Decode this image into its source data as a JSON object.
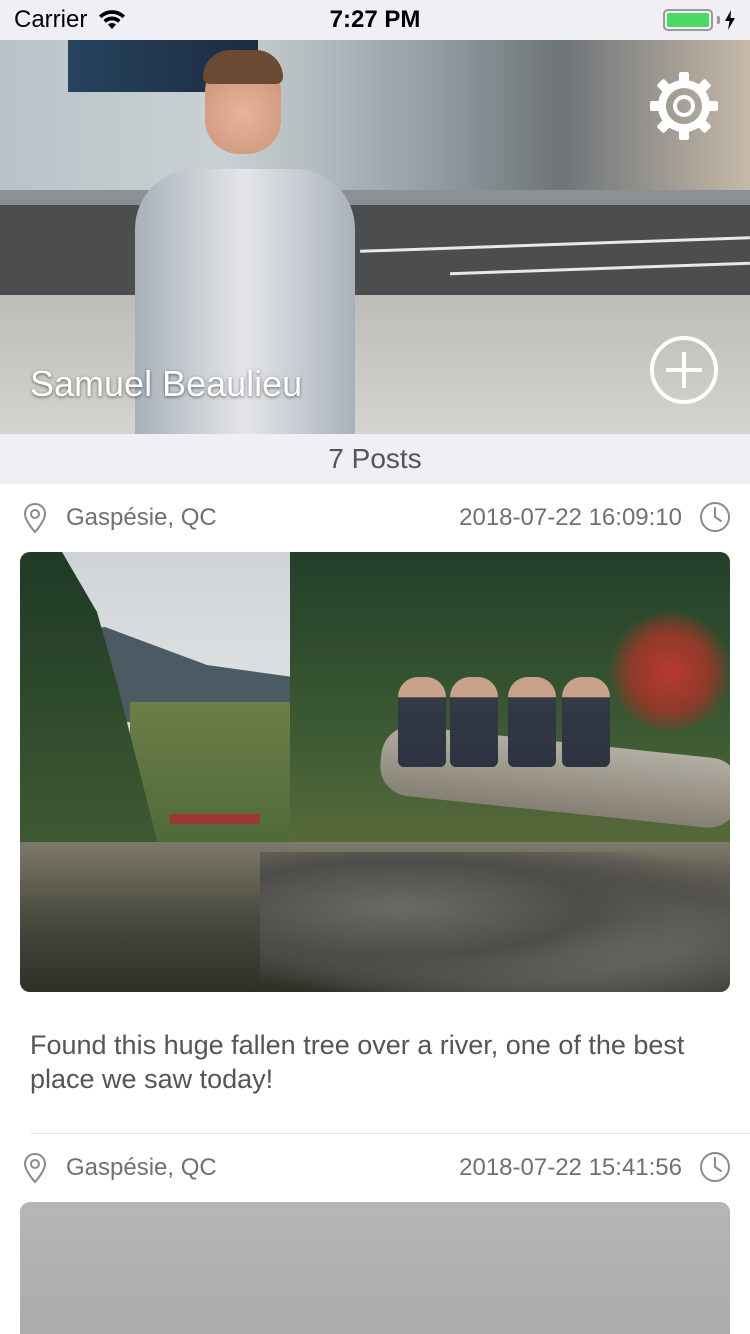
{
  "status_bar": {
    "carrier": "Carrier",
    "time": "7:27 PM",
    "battery_level": 1.0,
    "battery_color": "#4cd964"
  },
  "header": {
    "profile_name": "Samuel Beaulieu",
    "settings_icon": "gear-icon",
    "add_icon": "plus-circle-icon"
  },
  "posts_summary": {
    "label": "7 Posts"
  },
  "posts": [
    {
      "location": "Gaspésie, QC",
      "timestamp": "2018-07-22 16:09:10",
      "caption": "Found this huge fallen tree over a river, one of the best place we saw today!",
      "location_icon": "location-pin-icon",
      "time_icon": "clock-icon"
    },
    {
      "location": "Gaspésie, QC",
      "timestamp": "2018-07-22 15:41:56",
      "caption": "",
      "location_icon": "location-pin-icon",
      "time_icon": "clock-icon"
    }
  ]
}
